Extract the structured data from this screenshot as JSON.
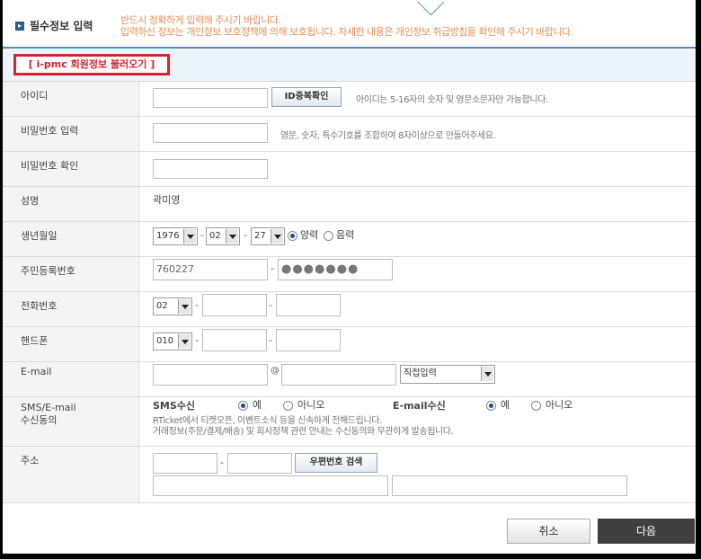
{
  "header": {
    "title": "필수정보 입력",
    "notice_line1": "반드시 정확하게 입력해 주시기 바랍니다.",
    "notice_line2": "입력하신 정보는 개인정보 보호정책에 의해 보호됩니다. 자세한 내용은 개인정보 취급방침을 확인해 주시기 바랍니다."
  },
  "load_member_button": "[ i-pmc 회원정보 불러오기 ]",
  "fields": {
    "id": {
      "label": "아이디",
      "value": "",
      "check_button": "ID중복확인",
      "hint": "아이디는 5-16자의 숫자 및 영문소문자만 가능합니다."
    },
    "password": {
      "label": "비밀번호 입력",
      "hint": "영문, 숫자, 특수기호를 조합하여 8자이상으로 만들어주세요."
    },
    "password_confirm": {
      "label": "비밀번호 확인"
    },
    "name": {
      "label": "성명",
      "value": "곽미영"
    },
    "birth": {
      "label": "생년월일",
      "year": "1976",
      "month": "02",
      "day": "27",
      "solar": "양력",
      "lunar": "음력",
      "selected": "양력"
    },
    "ssn": {
      "label": "주민등록번호",
      "front": "760227",
      "back_masked": "●●●●●●●"
    },
    "phone": {
      "label": "전화번호",
      "area": "02"
    },
    "mobile": {
      "label": "핸드폰",
      "prefix": "010"
    },
    "email": {
      "label": "E-mail",
      "at": "@",
      "domain_select": "직접입력"
    },
    "consent": {
      "label_line1": "SMS/E-mail",
      "label_line2": "수신동의",
      "sms_label": "SMS수신",
      "email_label": "E-mail수신",
      "yes": "예",
      "no": "아니오",
      "sms_selected": "예",
      "email_selected": "예",
      "note1": "RTicket에서 티켓오픈, 이벤트소식 등을 신속하게 전해드립니다.",
      "note2": "거래정보(주문/결제/배송) 및 회사정책 관련 안내는 수신동의와 무관하게 발송됩니다."
    },
    "address": {
      "label": "주소",
      "zip_search_button": "우편번호 검색"
    }
  },
  "footer": {
    "cancel": "취소",
    "next": "다음"
  }
}
